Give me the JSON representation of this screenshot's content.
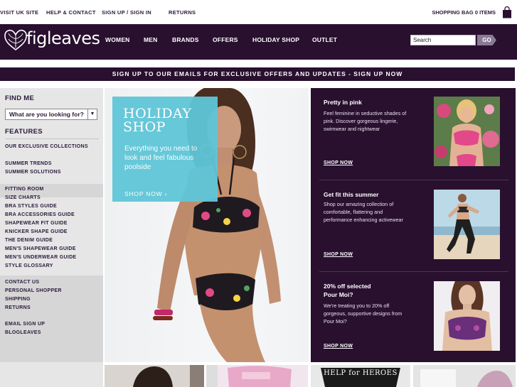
{
  "utility_bar": {
    "links": [
      "VISIT UK SITE",
      "HELP & CONTACT",
      "SIGN UP / SIGN IN",
      "RETURNS"
    ],
    "bag_label": "SHOPPING BAG",
    "bag_count": "0",
    "bag_items": "ITEMS"
  },
  "brand": {
    "logo_text": "figleaves"
  },
  "nav": {
    "items": [
      "WOMEN",
      "MEN",
      "BRANDS",
      "OFFERS",
      "HOLIDAY SHOP",
      "OUTLET"
    ],
    "search_value": "Search",
    "go_label": "GO"
  },
  "promo_strip": "SIGN UP TO OUR EMAILS FOR EXCLUSIVE OFFERS AND UPDATES - SIGN UP NOW",
  "sidebar": {
    "find_me": "FIND ME",
    "finder_placeholder": "What are you looking for?",
    "features": "FEATURES",
    "links": [
      "OUR EXCLUSIVE COLLECTIONS",
      "SUMMER TRENDS",
      "SUMMER SOLUTIONS",
      "FITTING ROOM",
      "SIZE CHARTS",
      "BRA STYLES GUIDE",
      "BRA ACCESSORIES GUIDE",
      "SHAPEWEAR FIT GUIDE",
      "KNICKER SHAPE GUIDE",
      "THE DENIM GUIDE",
      "MEN'S SHAPEWEAR GUIDE",
      "MEN'S UNDERWEAR GUIDE",
      "STYLE GLOSSARY",
      "CONTACT US",
      "PERSONAL SHOPPER",
      "SHIPPING",
      "RETURNS",
      "EMAIL SIGN UP",
      "BLOGLEAVES"
    ]
  },
  "hero": {
    "title_line1": "HOLIDAY",
    "title_line2": "SHOP",
    "subtitle": "Everything you need to look and feel fabulous poolside",
    "cta": "SHOP NOW"
  },
  "promos": [
    {
      "title": "Pretty in pink",
      "body": "Feel feminine in seductive shades of pink. Discover gorgeous lingerie, swimwear and nightwear",
      "cta": "SHOP NOW"
    },
    {
      "title": "Get fit this summer",
      "body": "Shop our amazing collection of comfortable, flattering and performance enhancing activewear",
      "cta": "SHOP NOW"
    },
    {
      "title": "20% off selected Pour Moi?",
      "body": "We're treating you to 20% off gorgeous, supportive designs from Pour Moi?",
      "cta": "SHOP NOW"
    }
  ],
  "bottom": {
    "help_for_heroes": "HELP for HEROES"
  },
  "colors": {
    "brand_purple": "#29102f",
    "accent_teal": "#5fc6d8"
  }
}
